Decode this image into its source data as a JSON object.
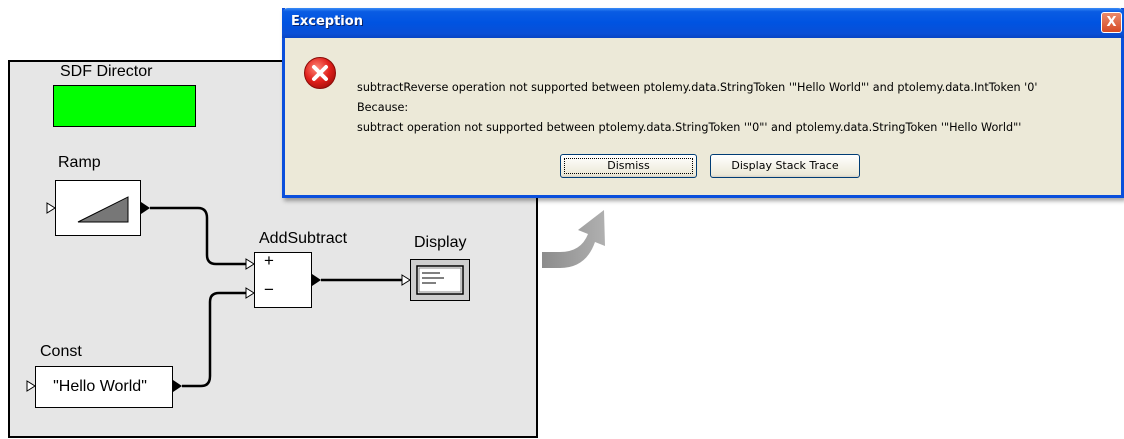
{
  "canvas": {
    "director": {
      "label": "SDF Director",
      "color": "#00ff00"
    },
    "actors": {
      "ramp": {
        "label": "Ramp"
      },
      "add_subtract": {
        "label": "AddSubtract",
        "plus": "+",
        "minus": "−"
      },
      "display": {
        "label": "Display"
      },
      "const": {
        "label": "Const",
        "value": "\"Hello World\""
      }
    }
  },
  "dialog": {
    "title": "Exception",
    "close_label": "X",
    "icon": "error-icon",
    "message_lines": [
      "subtractReverse operation not supported between ptolemy.data.StringToken '\"Hello World\"' and ptolemy.data.IntToken '0'",
      "Because:",
      "subtract operation not supported between ptolemy.data.StringToken '\"0\"' and ptolemy.data.StringToken '\"Hello World\"'"
    ],
    "buttons": {
      "dismiss": "Dismiss",
      "stack_trace": "Display Stack Trace"
    },
    "colors": {
      "titlebar": "#0053e1",
      "body": "#ece9d8",
      "error_red": "#e0201b"
    }
  }
}
